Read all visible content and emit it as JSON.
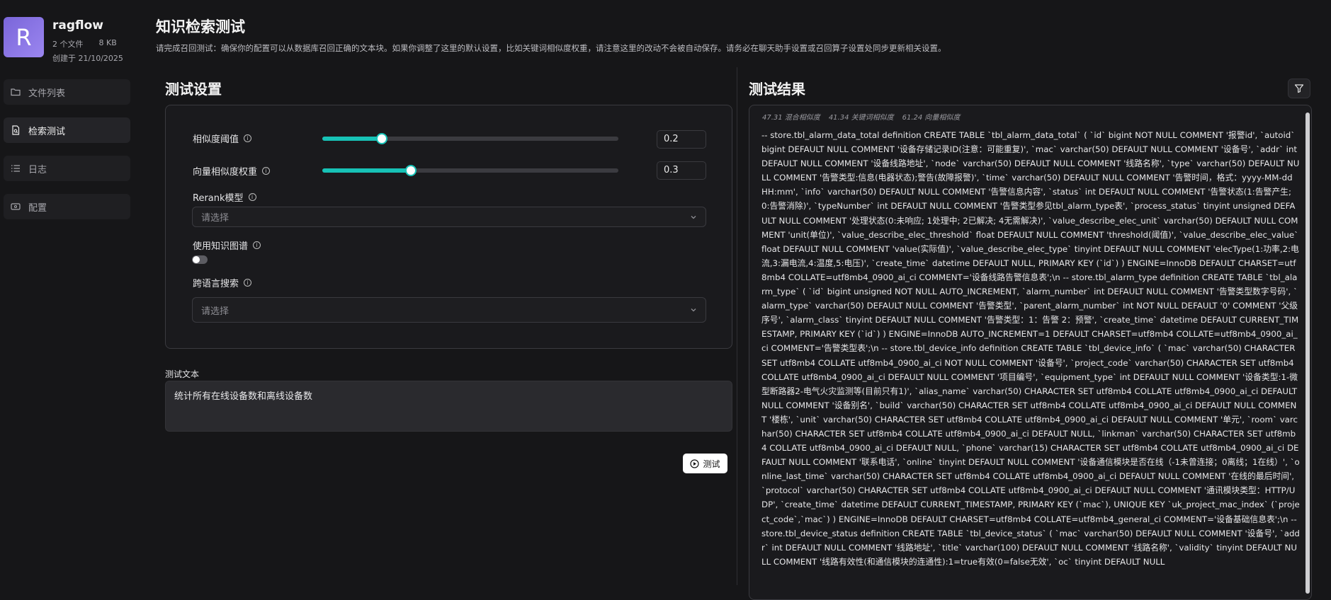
{
  "sidebar": {
    "avatar_letter": "R",
    "kb_name": "ragflow",
    "file_count": "2 个文件",
    "size": "8 KB",
    "created": "创建于 21/10/2025",
    "items": [
      {
        "label": "文件列表",
        "icon": "folder-icon"
      },
      {
        "label": "检索测试",
        "icon": "doc-search-icon"
      },
      {
        "label": "日志",
        "icon": "list-icon"
      },
      {
        "label": "配置",
        "icon": "settings-card-icon"
      }
    ],
    "active_index": 1
  },
  "header": {
    "title": "知识检索测试",
    "description": "请完成召回测试：确保你的配置可以从数据库召回正确的文本块。如果你调整了这里的默认设置，比如关键词相似度权重，请注意这里的改动不会被自动保存。请务必在聊天助手设置或召回算子设置处同步更新相关设置。"
  },
  "settings": {
    "title": "测试设置",
    "similarity_threshold": {
      "label": "相似度阈值",
      "value": "0.2",
      "fraction": 0.2
    },
    "vector_weight": {
      "label": "向量相似度权重",
      "value": "0.3",
      "fraction": 0.3
    },
    "rerank": {
      "label": "Rerank模型",
      "placeholder": "请选择"
    },
    "knowledge_graph": {
      "label": "使用知识图谱",
      "enabled": false
    },
    "cross_lang": {
      "label": "跨语言搜索",
      "placeholder": "请选择"
    },
    "test_text_label": "测试文本",
    "test_text": "统计所有在线设备数和离线设备数",
    "test_button": "测试"
  },
  "results": {
    "title": "测试结果",
    "scores": {
      "hybrid": "47.31 混合相似度",
      "keyword": "41.34 关键词相似度",
      "vector": "61.24 向量相似度"
    },
    "content": "-- store.tbl_alarm_data_total definition CREATE TABLE `tbl_alarm_data_total` ( `id` bigint NOT NULL COMMENT '报警id', `autoid` bigint DEFAULT NULL COMMENT '设备存储记录ID(注意：可能重复)', `mac` varchar(50) DEFAULT NULL COMMENT '设备号', `addr` int DEFAULT NULL COMMENT '设备线路地址', `node` varchar(50) DEFAULT NULL COMMENT '线路名称', `type` varchar(50) DEFAULT NULL COMMENT '告警类型:信息(电器状态);警告(故障报警)', `time` varchar(50) DEFAULT NULL COMMENT '告警时间，格式：yyyy-MM-dd HH:mm', `info` varchar(50) DEFAULT NULL COMMENT '告警信息内容', `status` int DEFAULT NULL COMMENT '告警状态(1:告警产生; 0:告警消除)', `typeNumber` int DEFAULT NULL COMMENT '告警类型参见tbl_alarm_type表', `process_status` tinyint unsigned DEFAULT NULL COMMENT '处理状态(0:未响应; 1处理中; 2已解决; 4无需解决)', `value_describe_elec_unit` varchar(50) DEFAULT NULL COMMENT 'unit(单位)', `value_describe_elec_threshold` float DEFAULT NULL COMMENT 'threshold(阈值)', `value_describe_elec_value` float DEFAULT NULL COMMENT 'value(实际值)', `value_describe_elec_type` tinyint DEFAULT NULL COMMENT 'elecType(1:功率,2:电流,3:漏电流,4:温度,5:电压)', `create_time` datetime DEFAULT NULL, PRIMARY KEY (`id`) ) ENGINE=InnoDB DEFAULT CHARSET=utf8mb4 COLLATE=utf8mb4_0900_ai_ci COMMENT='设备线路告警信息表';\\n -- store.tbl_alarm_type definition CREATE TABLE `tbl_alarm_type` ( `id` bigint unsigned NOT NULL AUTO_INCREMENT, `alarm_number` int DEFAULT NULL COMMENT '告警类型数字号码', `alarm_type` varchar(50) DEFAULT NULL COMMENT '告警类型', `parent_alarm_number` int NOT NULL DEFAULT '0' COMMENT '父级序号', `alarm_class` tinyint DEFAULT NULL COMMENT '告警类型：1：告警 2：预警', `create_time` datetime DEFAULT CURRENT_TIMESTAMP, PRIMARY KEY (`id`) ) ENGINE=InnoDB AUTO_INCREMENT=1 DEFAULT CHARSET=utf8mb4 COLLATE=utf8mb4_0900_ai_ci COMMENT='告警类型表';\\n -- store.tbl_device_info definition CREATE TABLE `tbl_device_info` ( `mac` varchar(50) CHARACTER SET utf8mb4 COLLATE utf8mb4_0900_ai_ci NOT NULL COMMENT '设备号', `project_code` varchar(50) CHARACTER SET utf8mb4 COLLATE utf8mb4_0900_ai_ci DEFAULT NULL COMMENT '项目编号', `equipment_type` int DEFAULT NULL COMMENT '设备类型:1-微型断路器2-电气火灾监测等(目前只有1)', `alias_name` varchar(50) CHARACTER SET utf8mb4 COLLATE utf8mb4_0900_ai_ci DEFAULT NULL COMMENT '设备别名', `build` varchar(50) CHARACTER SET utf8mb4 COLLATE utf8mb4_0900_ai_ci DEFAULT NULL COMMENT '楼栋', `unit` varchar(50) CHARACTER SET utf8mb4 COLLATE utf8mb4_0900_ai_ci DEFAULT NULL COMMENT '单元', `room` varchar(50) CHARACTER SET utf8mb4 COLLATE utf8mb4_0900_ai_ci DEFAULT NULL, `linkman` varchar(50) CHARACTER SET utf8mb4 COLLATE utf8mb4_0900_ai_ci DEFAULT NULL, `phone` varchar(15) CHARACTER SET utf8mb4 COLLATE utf8mb4_0900_ai_ci DEFAULT NULL COMMENT '联系电话', `online` tinyint DEFAULT NULL COMMENT '设备通信模块是否在线（-1未曾连接；0离线；1在线）', `online_last_time` varchar(50) CHARACTER SET utf8mb4 COLLATE utf8mb4_0900_ai_ci DEFAULT NULL COMMENT '在线的最后时间', `protocol` varchar(50) CHARACTER SET utf8mb4 COLLATE utf8mb4_0900_ai_ci DEFAULT NULL COMMENT '通讯模块类型：HTTP/UDP', `create_time` datetime DEFAULT CURRENT_TIMESTAMP, PRIMARY KEY (`mac`), UNIQUE KEY `uk_project_mac_index` (`project_code`,`mac`) ) ENGINE=InnoDB DEFAULT CHARSET=utf8mb4 COLLATE=utf8mb4_general_ci COMMENT='设备基础信息表';\\n -- store.tbl_device_status definition CREATE TABLE `tbl_device_status` ( `mac` varchar(50) DEFAULT NULL COMMENT '设备号', `addr` int DEFAULT NULL COMMENT '线路地址', `title` varchar(100) DEFAULT NULL COMMENT '线路名称', `validity` tinyint DEFAULT NULL COMMENT '线路有效性(和通信模块的连通性):1=true有效(0=false无效', `oc` tinyint DEFAULT NULL"
  },
  "colors": {
    "accent": "#17c2b6",
    "avatar": "#8a76e6",
    "background": "#161618"
  }
}
